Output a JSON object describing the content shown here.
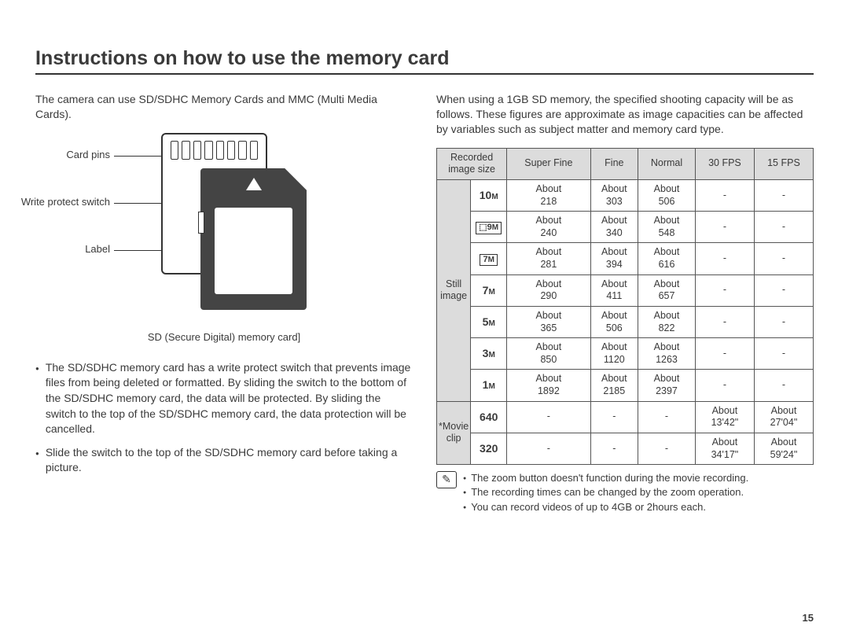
{
  "title": "Instructions on how to use the memory card",
  "left": {
    "intro": "The camera can use SD/SDHC Memory Cards and MMC (Multi Media Cards).",
    "callouts": {
      "pins": "Card pins",
      "switch": "Write protect switch",
      "label": "Label"
    },
    "caption": "SD (Secure Digital) memory card]",
    "bullets": [
      "The SD/SDHC memory card has a write protect switch that prevents image files from being deleted or formatted. By sliding the switch to the bottom of the SD/SDHC memory card, the data will be protected. By sliding the switch to the top of the SD/SDHC memory card, the data protection will be cancelled.",
      "Slide the switch to the top of the SD/SDHC memory card before taking a picture."
    ]
  },
  "right": {
    "intro": "When using a 1GB SD memory, the specified shooting capacity will be as follows. These figures are approximate as image capacities can be affected by variables such as subject matter and memory card type.",
    "headers": {
      "size": "Recorded image size",
      "sf": "Super Fine",
      "fine": "Fine",
      "normal": "Normal",
      "fps30": "30 FPS",
      "fps15": "15 FPS"
    },
    "cat_still": "Still image",
    "cat_movie": "*Movie clip",
    "still_rows": [
      {
        "label_html": "10<span class='m'>M</span>",
        "sf": "About 218",
        "fine": "About 303",
        "normal": "About 506"
      },
      {
        "label_html": "<span class='icon-boxed'>⬚9<span class='m'>M</span></span>",
        "sf": "About 240",
        "fine": "About 340",
        "normal": "About 548"
      },
      {
        "label_html": "<span class='icon-boxed'>7<span class='m'>M</span></span>",
        "sf": "About 281",
        "fine": "About 394",
        "normal": "About 616"
      },
      {
        "label_html": "7<span class='m'>M</span>",
        "sf": "About 290",
        "fine": "About 411",
        "normal": "About 657"
      },
      {
        "label_html": "5<span class='m'>M</span>",
        "sf": "About 365",
        "fine": "About 506",
        "normal": "About 822"
      },
      {
        "label_html": "3<span class='m'>M</span>",
        "sf": "About 850",
        "fine": "About 1120",
        "normal": "About 1263"
      },
      {
        "label_html": "1<span class='m'>M</span>",
        "sf": "About 1892",
        "fine": "About 2185",
        "normal": "About 2397"
      }
    ],
    "movie_rows": [
      {
        "label": "640",
        "fps30": "About 13'42\"",
        "fps15": "About 27'04\""
      },
      {
        "label": "320",
        "fps30": "About 34'17\"",
        "fps15": "About 59'24\""
      }
    ],
    "notes": [
      "The zoom button doesn't function during the movie recording.",
      "The recording times can be changed by the zoom operation.",
      "You can record videos of up to 4GB or 2hours each."
    ]
  },
  "page": "15"
}
